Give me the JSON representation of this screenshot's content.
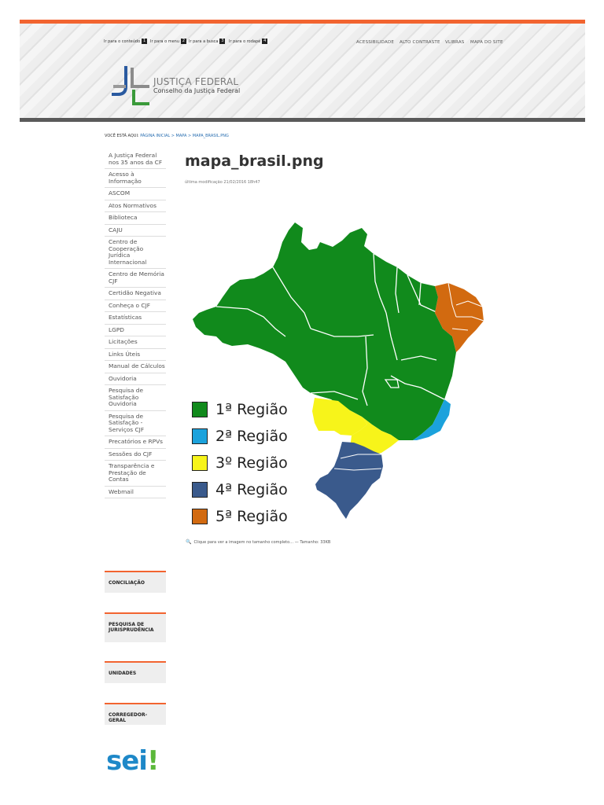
{
  "skip_links": [
    {
      "label": "Ir para o conteúdo",
      "num": "1"
    },
    {
      "label": "Ir para o menu",
      "num": "2"
    },
    {
      "label": "Ir para a busca",
      "num": "3"
    },
    {
      "label": "Ir para o rodapé",
      "num": "4"
    }
  ],
  "top_links": [
    "ACESSIBILIDADE",
    "ALTO CONTRASTE",
    "VLIBRAS",
    "MAPA DO SITE"
  ],
  "logo": {
    "title": "JUSTIÇA FEDERAL",
    "subtitle": "Conselho da Justiça Federal"
  },
  "breadcrumb": {
    "prefix": "VOCÊ ESTÁ AQUI:",
    "path": "PÁGINA INICIAL > MAPA > MAPA_BRASIL.PNG"
  },
  "sidebar": [
    "A Justiça Federal nos 35 anos da CF",
    "Acesso à Informação",
    "ASCOM",
    "Atos Normativos",
    "Biblioteca",
    "CAJU",
    "Centro de Cooperação Jurídica Internacional",
    "Centro de Memória CJF",
    "Certidão Negativa",
    "Conheça o CJF",
    "Estatísticas",
    "LGPD",
    "Licitações",
    "Links Úteis",
    "Manual de Cálculos",
    "Ouvidoria",
    "Pesquisa de Satisfação Ouvidoria",
    "Pesquisa de Satisfação - Serviços CJF",
    "Precatórios e RPVs",
    "Sessões do CJF",
    "Transparência e Prestação de Contas",
    "Webmail"
  ],
  "boxes": [
    "CONCILIAÇÃO",
    "PESQUISA DE JURISPRUDÊNCIA",
    "UNIDADES",
    "CORREGEDOR-GERAL"
  ],
  "sei_logo": {
    "text": "sei",
    "mark": "!"
  },
  "page": {
    "title": "mapa_brasil.png",
    "modified": "última modificação 21/02/2016 18h47",
    "caption": "Clique para ver a imagem no tamanho completo… — Tamanho: 33KB"
  },
  "legend": [
    {
      "label": "1ª Região",
      "color": "#118a1c"
    },
    {
      "label": "2ª Região",
      "color": "#1ba2dc"
    },
    {
      "label": "3º Região",
      "color": "#f7f41a"
    },
    {
      "label": "4ª Região",
      "color": "#3a5a8c"
    },
    {
      "label": "5ª Região",
      "color": "#d26a10"
    }
  ],
  "colors": {
    "accent": "#f26430",
    "link": "#2a6fb1",
    "header_bottom": "#5a5a5a"
  }
}
